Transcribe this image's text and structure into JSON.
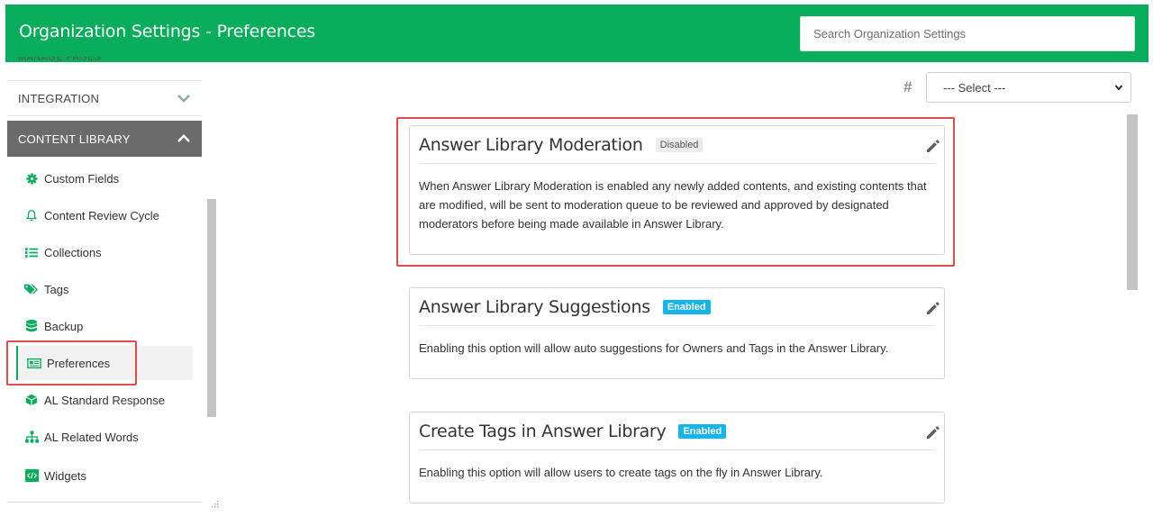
{
  "header": {
    "title": "Organization Settings - Preferences",
    "search_placeholder": "Search Organization Settings"
  },
  "sidebar": {
    "cut_off_label": "MANAGE PAGES",
    "sections": [
      {
        "label": "INTEGRATION",
        "expanded": false
      },
      {
        "label": "CONTENT LIBRARY",
        "expanded": true
      }
    ],
    "items": [
      {
        "label": "Custom Fields",
        "icon": "gear-icon"
      },
      {
        "label": "Content Review Cycle",
        "icon": "bell-icon"
      },
      {
        "label": "Collections",
        "icon": "list-icon"
      },
      {
        "label": "Tags",
        "icon": "tags-icon"
      },
      {
        "label": "Backup",
        "icon": "database-icon"
      },
      {
        "label": "Preferences",
        "icon": "newspaper-icon",
        "active": true
      },
      {
        "label": "AL Standard Response",
        "icon": "cube-icon"
      },
      {
        "label": "AL Related Words",
        "icon": "sitemap-icon"
      },
      {
        "label": "Widgets",
        "icon": "code-icon"
      }
    ]
  },
  "filter": {
    "hash_label": "#",
    "select_value": "--- Select ---"
  },
  "cards": [
    {
      "title": "Answer Library Moderation",
      "status": "Disabled",
      "description": "When Answer Library Moderation is enabled any newly added contents, and existing contents that are modified, will be sent to moderation queue to be reviewed and approved by designated moderators before being made available in Answer Library."
    },
    {
      "title": "Answer Library Suggestions",
      "status": "Enabled",
      "description": "Enabling this option will allow auto suggestions for Owners and Tags in the Answer Library."
    },
    {
      "title": "Create Tags in Answer Library",
      "status": "Enabled",
      "description": "Enabling this option will allow users to create tags on the fly in Answer Library."
    }
  ],
  "colors": {
    "brand_green": "#06ad5a",
    "highlight_red": "#e04b4b",
    "enabled_badge": "#14b4ec"
  }
}
